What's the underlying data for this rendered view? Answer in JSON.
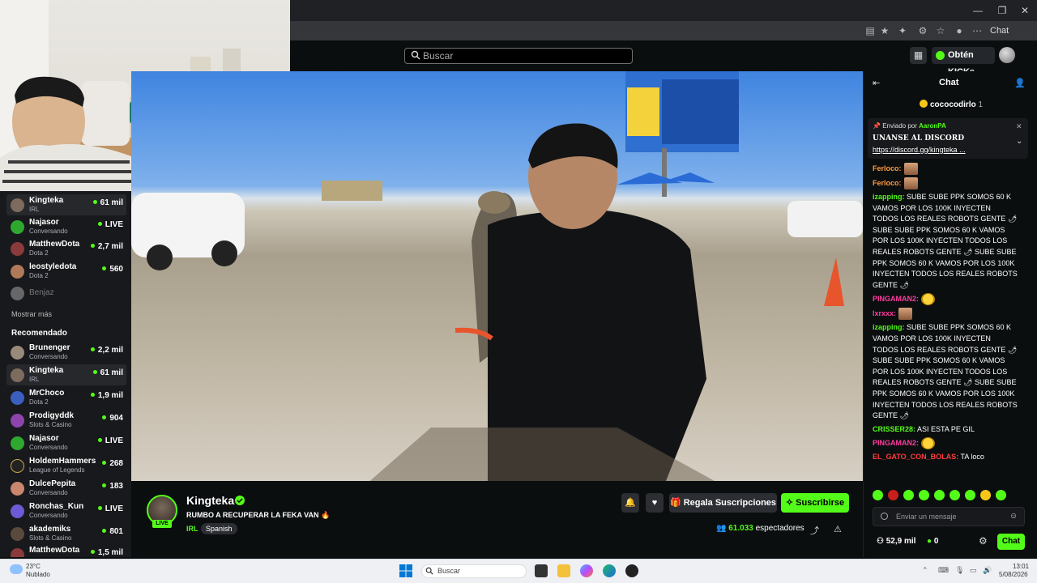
{
  "browser": {
    "chat_button": "Chat"
  },
  "header": {
    "search_placeholder": "Buscar",
    "kicks_button": "Obtén KICKs"
  },
  "sidebar": {
    "following": [
      {
        "name": "Kingteka",
        "sub": "IRL",
        "viewers": "61 mil",
        "active": true
      },
      {
        "name": "Najasor",
        "sub": "Conversando",
        "viewers": "LIVE"
      },
      {
        "name": "MatthewDota",
        "sub": "Dota 2",
        "viewers": "2,7 mil"
      },
      {
        "name": "leostyledota",
        "sub": "Dota 2",
        "viewers": "560"
      },
      {
        "name": "Benjaz",
        "sub": "",
        "viewers": ""
      }
    ],
    "show_more": "Mostrar más",
    "recommended_title": "Recomendado",
    "recommended": [
      {
        "name": "Brunenger",
        "sub": "Conversando",
        "viewers": "2,2 mil"
      },
      {
        "name": "Kingteka",
        "sub": "IRL",
        "viewers": "61 mil",
        "active": true
      },
      {
        "name": "MrChoco",
        "sub": "Dota 2",
        "viewers": "1,9 mil"
      },
      {
        "name": "Prodigyddk",
        "sub": "Slots & Casino",
        "viewers": "904"
      },
      {
        "name": "Najasor",
        "sub": "Conversando",
        "viewers": "LIVE"
      },
      {
        "name": "HoldemHammers",
        "sub": "League of Legends",
        "viewers": "268"
      },
      {
        "name": "DulcePepita",
        "sub": "Conversando",
        "viewers": "183"
      },
      {
        "name": "Ronchas_Kun",
        "sub": "Conversando",
        "viewers": "LIVE"
      },
      {
        "name": "akademiks",
        "sub": "Slots & Casino",
        "viewers": "801"
      },
      {
        "name": "MatthewDota",
        "sub": "",
        "viewers": "1,5 mil"
      }
    ]
  },
  "channel": {
    "name": "Kingteka",
    "live_badge": "LIVE",
    "title": "RUMBO A RECUPERAR LA FEKA VAN 🔥",
    "category": "IRL",
    "language": "Spanish",
    "gift_button": "Regala Suscripciones",
    "subscribe_button": "Suscribirse",
    "viewer_count": "61.033",
    "viewer_label": "espectadores"
  },
  "chat": {
    "title": "Chat",
    "top_gifter": "cococodirlo",
    "top_gifter_count": "1",
    "pinned_by_label": "Enviado por",
    "pinned_by": "AaronPA",
    "pinned_message": "UNANSE AL DISCORD",
    "pinned_link": "https://discord.gg/kingteka",
    "pinned_more": "...",
    "messages": [
      {
        "user": "Ferloco:",
        "color": "#ff9a3c",
        "text": "",
        "emote": "face"
      },
      {
        "user": "Ferloco:",
        "color": "#ff9a3c",
        "text": "",
        "emote": "face"
      },
      {
        "user": "izapping:",
        "color": "#53fc18",
        "text": " SUBE SUBE PPK SOMOS 60 K VAMOS POR LOS 100K INYECTEN TODOS LOS REALES ROBOTS GENTE 🌶 SUBE SUBE PPK SOMOS 60 K VAMOS POR LOS 100K INYECTEN TODOS LOS REALES ROBOTS GENTE 🌶 SUBE SUBE PPK SOMOS 60 K VAMOS POR LOS 100K INYECTEN TODOS LOS REALES ROBOTS GENTE 🌶",
        "emote": ""
      },
      {
        "user": "PINGAMAN2:",
        "color": "#ff3ca0",
        "text": "",
        "emote": "smile"
      },
      {
        "user": "lxrxxx:",
        "color": "#ff3ca0",
        "text": "",
        "emote": "face"
      },
      {
        "user": "izapping:",
        "color": "#53fc18",
        "text": " SUBE SUBE PPK SOMOS 60 K VAMOS POR LOS 100K INYECTEN TODOS LOS REALES ROBOTS GENTE 🌶 SUBE SUBE PPK SOMOS 60 K VAMOS POR LOS 100K INYECTEN TODOS LOS REALES ROBOTS GENTE 🌶 SUBE SUBE PPK SOMOS 60 K VAMOS POR LOS 100K INYECTEN TODOS LOS REALES ROBOTS GENTE 🌶",
        "emote": ""
      },
      {
        "user": "CRISSER28:",
        "color": "#53fc18",
        "text": " ASI ESTA PE GIL",
        "emote": ""
      },
      {
        "user": "PINGAMAN2:",
        "color": "#ff3ca0",
        "text": "",
        "emote": "smile"
      },
      {
        "user": "EL_GATO_CON_BOLAS:",
        "color": "#ff3c3c",
        "text": " TA loco",
        "emote": ""
      }
    ],
    "input_placeholder": "Enviar un mensaje",
    "points": "52,9 mil",
    "kicks": "0",
    "send_button": "Chat"
  },
  "taskbar": {
    "temperature": "23°C",
    "condition": "Nublado",
    "search": "Buscar",
    "time": "13:01",
    "date": "5/08/2026"
  },
  "colors": {
    "accent": "#53fc18",
    "background": "#0b0e0f",
    "panel": "#18191c"
  }
}
